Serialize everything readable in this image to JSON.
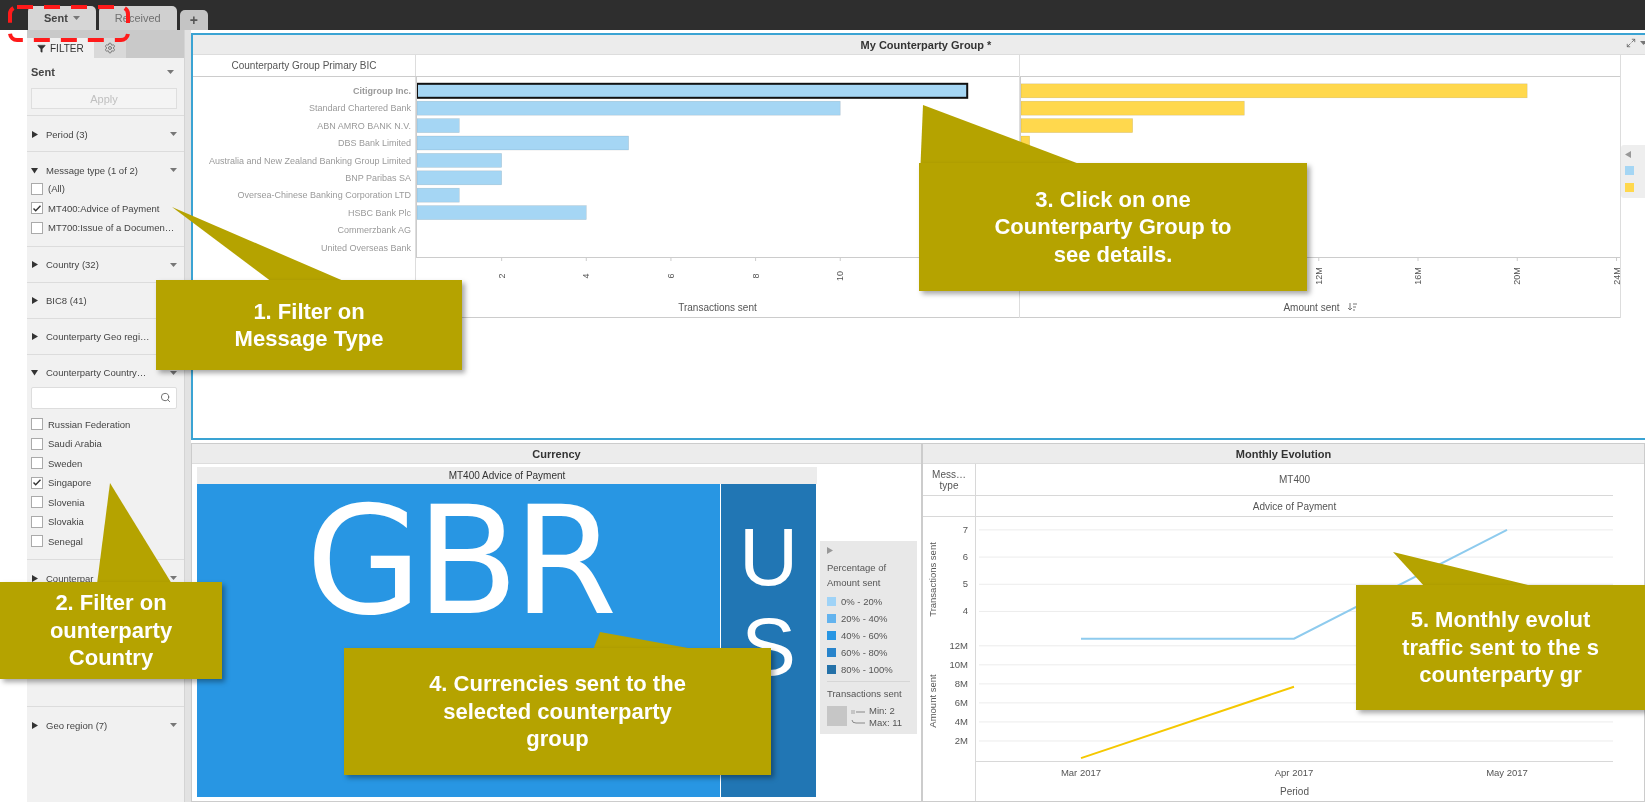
{
  "tabs": [
    {
      "label": "Sent",
      "selected": true
    },
    {
      "label": "Received",
      "selected": false
    }
  ],
  "add_tab": "+",
  "sidebar": {
    "panel_tabs": [
      {
        "kind": "filter",
        "label": "FILTER",
        "selected": true
      },
      {
        "kind": "settings",
        "selected": false
      }
    ],
    "view_select": "Sent",
    "apply": {
      "label": "Apply",
      "disabled": true
    },
    "filters": [
      {
        "label": "Period (3)",
        "expanded": false
      },
      {
        "label": "Message type (1 of 2)",
        "expanded": true,
        "options": [
          {
            "label": "(All)",
            "checked": false
          },
          {
            "label": "MT400:Advice of Payment",
            "checked": true
          },
          {
            "label": "MT700:Issue of a Documen…",
            "checked": false
          }
        ]
      },
      {
        "label": "Country (32)",
        "expanded": false
      },
      {
        "label": "BIC8 (41)",
        "expanded": false
      },
      {
        "label": "Counterparty Geo regi…",
        "expanded": false
      },
      {
        "label": "Counterparty Country…",
        "expanded": true,
        "search": true,
        "options": [
          {
            "label": "Russian Federation",
            "checked": false
          },
          {
            "label": "Saudi Arabia",
            "checked": false
          },
          {
            "label": "Sweden",
            "checked": false
          },
          {
            "label": "Singapore",
            "checked": true
          },
          {
            "label": "Slovenia",
            "checked": false
          },
          {
            "label": "Slovakia",
            "checked": false
          },
          {
            "label": "Senegal",
            "checked": false
          }
        ]
      },
      {
        "label": "Counterpar",
        "expanded": false
      },
      {
        "label": "Geo region (7)",
        "expanded": false
      }
    ]
  },
  "group_panel": {
    "title": "My Counterparty Group *",
    "row_header": "Counterparty Group Primary BIC",
    "selected_rows": [
      true,
      false,
      false,
      false,
      false,
      false,
      false,
      false,
      false,
      false
    ],
    "transactions": {
      "chart_data": {
        "type": "bar",
        "orientation": "horizontal",
        "xlabel": "Transactions sent",
        "categories": [
          "Citigroup Inc.",
          "Standard Chartered Bank",
          "ABN AMRO BANK N.V.",
          "DBS Bank Limited",
          "Australia and New Zealand Banking Group Limited",
          "BNP Paribas SA",
          "Oversea-Chinese Banking Corporation LTD",
          "HSBC Bank Plc",
          "Commerzbank AG",
          "United Overseas Bank"
        ],
        "xlim": [
          0,
          14.2
        ],
        "xticks": [
          2,
          4,
          6,
          8,
          10
        ],
        "series": [
          {
            "color": "#a5d6f4",
            "values": [
              13,
              10,
              1,
              5,
              2,
              2,
              1,
              4,
              0,
              0
            ]
          }
        ]
      }
    },
    "amount": {
      "chart_data": {
        "type": "bar",
        "orientation": "horizontal",
        "xlabel": "Amount sent",
        "xlim": [
          0,
          24100000
        ],
        "xticks": [
          {
            "value": 12000000,
            "label": "12M"
          },
          {
            "value": 16000000,
            "label": "16M"
          },
          {
            "value": 20000000,
            "label": "20M"
          },
          {
            "value": 24000000,
            "label": "24M"
          }
        ],
        "series": [
          {
            "color": "#ffd84d",
            "values": [
              20400000,
              9000000,
              4500000,
              350000,
              null,
              null,
              null,
              null,
              null,
              null
            ]
          }
        ]
      }
    }
  },
  "currency_panel": {
    "title": "Currency",
    "treemap_header": "MT400 Advice of Payment",
    "tiles": [
      {
        "label": "GBR",
        "color": "#2896e3"
      },
      {
        "label": "US",
        "color": "#2176b4"
      }
    ],
    "legend": {
      "title": "Percentage of Amount sent",
      "items": [
        {
          "label": "0% - 20%",
          "color": "#9fd3f7"
        },
        {
          "label": "20% - 40%",
          "color": "#63b3ee"
        },
        {
          "label": "40% - 60%",
          "color": "#2896e3"
        },
        {
          "label": "60% - 80%",
          "color": "#2884cb"
        },
        {
          "label": "80% - 100%",
          "color": "#2471a8"
        }
      ],
      "size_title": "Transactions sent",
      "min": "Min: 2",
      "max": "Max: 11"
    }
  },
  "monthly_panel": {
    "title": "Monthly Evolution",
    "column_header": "Mess… type",
    "message_type": "MT400",
    "message_name": "Advice of Payment",
    "transactions": {
      "chart_data": {
        "type": "line",
        "ylabel": "Transactions sent",
        "grid": true,
        "ylim": [
          2.95,
          7.4
        ],
        "yticks": [
          4,
          5,
          6,
          7
        ],
        "series": [
          {
            "color": "#8ecbee",
            "values": [
              3,
              3,
              7
            ]
          }
        ]
      }
    },
    "amount": {
      "chart_data": {
        "type": "line",
        "ylabel": "Amount sent",
        "xlabel": "Period",
        "grid": true,
        "categories": [
          "Mar 2017",
          "Apr 2017",
          "May 2017"
        ],
        "ylim": [
          0,
          12400000
        ],
        "yticks": [
          {
            "value": 2000000,
            "label": "2M"
          },
          {
            "value": 4000000,
            "label": "4M"
          },
          {
            "value": 6000000,
            "label": "6M"
          },
          {
            "value": 8000000,
            "label": "8M"
          },
          {
            "value": 10000000,
            "label": "10M"
          },
          {
            "value": 12000000,
            "label": "12M"
          }
        ],
        "series": [
          {
            "color": "#f5c800",
            "values": [
              200000,
              7700000,
              null
            ]
          }
        ]
      }
    }
  },
  "callouts": [
    {
      "lines": [
        "1. Filter on",
        "Message Type"
      ]
    },
    {
      "lines": [
        "2. Filter on",
        "ounterparty",
        "Country"
      ]
    },
    {
      "lines": [
        "3. Click on one",
        "Counterparty Group to",
        "see details."
      ]
    },
    {
      "lines": [
        "4. Currencies sent to the",
        "selected counterparty",
        "group"
      ]
    },
    {
      "lines": [
        "5. Monthly evolut",
        "traffic sent to the s",
        "counterparty gr"
      ]
    }
  ]
}
